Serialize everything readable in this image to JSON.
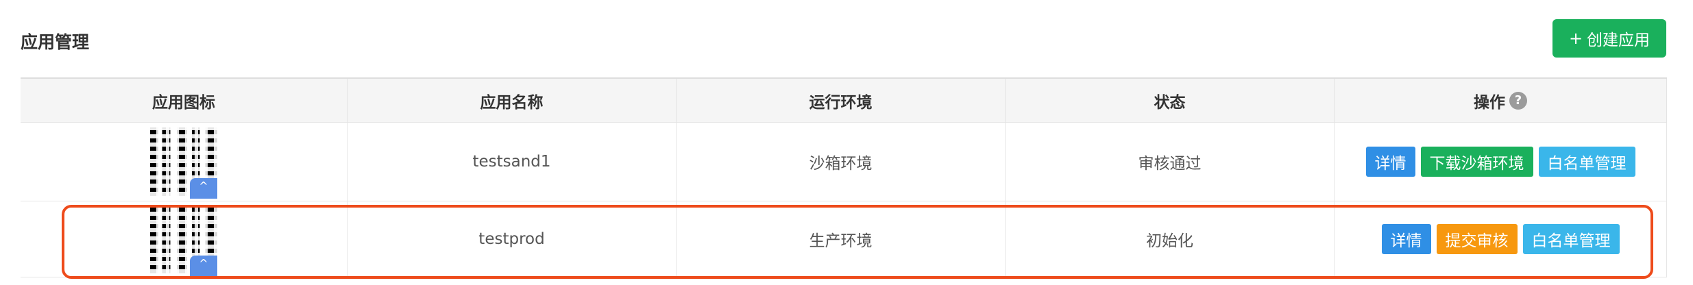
{
  "page": {
    "title": "应用管理",
    "create_button": "创建应用",
    "create_icon": "+"
  },
  "table": {
    "headers": [
      "应用图标",
      "应用名称",
      "运行环境",
      "状态",
      "操作"
    ],
    "help_icon": "?",
    "rows": [
      {
        "name": "testsand1",
        "env": "沙箱环境",
        "status": "审核通过",
        "actions": [
          "详情",
          "下载沙箱环境",
          "白名单管理"
        ]
      },
      {
        "name": "testprod",
        "env": "生产环境",
        "status": "初始化",
        "actions": [
          "详情",
          "提交审核",
          "白名单管理"
        ]
      }
    ]
  },
  "colors": {
    "primary_green": "#1ab05c",
    "detail_blue": "#2f8fe5",
    "submit_orange": "#f7980f",
    "whitelist_cyan": "#3ab6ea",
    "highlight_red": "#ee4b1b"
  }
}
